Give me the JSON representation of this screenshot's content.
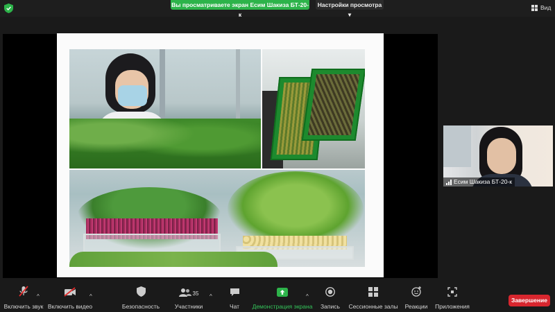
{
  "top_bar": {
    "share_banner": "Вы просматриваете экран Есим Шакиза БТ-20-к",
    "view_options": "Настройки просмотра",
    "view_button": "Вид"
  },
  "participant": {
    "name": "Есим Шакиза БТ-20-к"
  },
  "toolbar": {
    "mic": "Включить звук",
    "video": "Включить видео",
    "security": "Безопасность",
    "participants": "Участники",
    "participants_count": "35",
    "chat": "Чат",
    "share": "Демонстрация экрана",
    "record": "Запись",
    "breakout": "Сессионные залы",
    "reactions": "Реакции",
    "apps": "Приложения",
    "end": "Завершение"
  },
  "colors": {
    "accent_green": "#2db34a",
    "end_red": "#d8262e",
    "background": "#1a1a1a"
  }
}
